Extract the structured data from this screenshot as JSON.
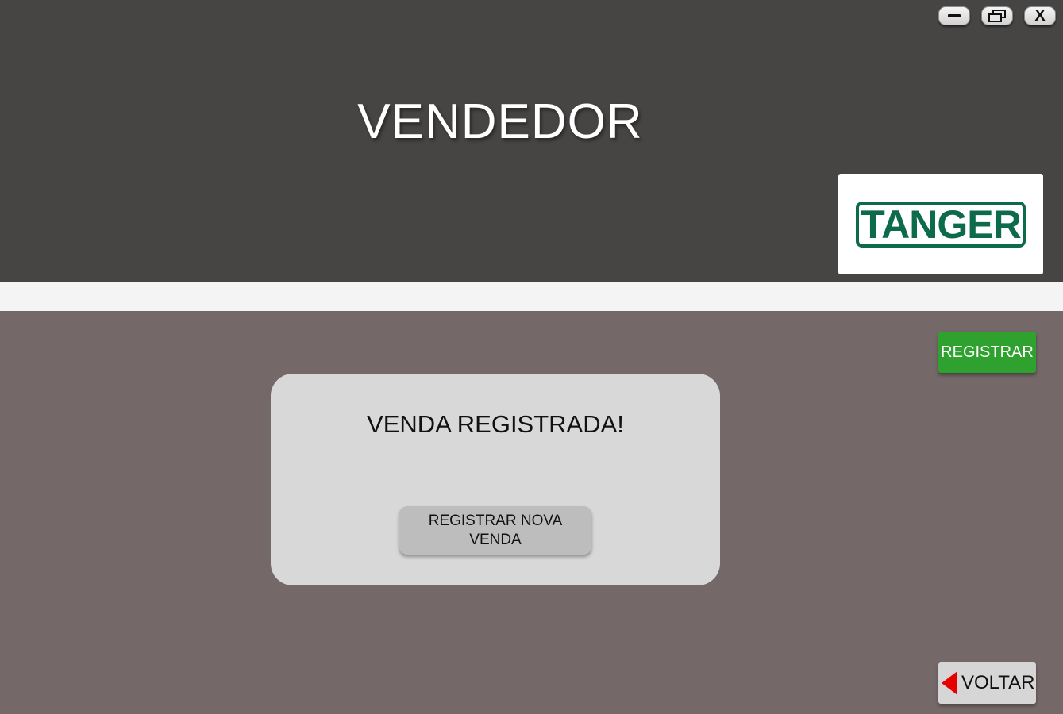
{
  "header": {
    "title": "VENDEDOR",
    "background_color": "#474544",
    "logo_text": "TANGER",
    "logo_color": "#0d6b4b"
  },
  "window_controls": {
    "minimize_icon": "minimize-icon",
    "maximize_icon": "maximize-icon",
    "close_label": "X"
  },
  "toolbar": {
    "registrar_label": "REGISTRAR",
    "registrar_color": "#2fa12f"
  },
  "dialog": {
    "message": "VENDA REGISTRADA!",
    "new_sale_button_label": "REGISTRAR NOVA VENDA"
  },
  "footer": {
    "back_label": "VOLTAR",
    "back_icon": "left-arrow-icon",
    "back_icon_color": "#e60000"
  },
  "main": {
    "background_color": "#756868"
  }
}
